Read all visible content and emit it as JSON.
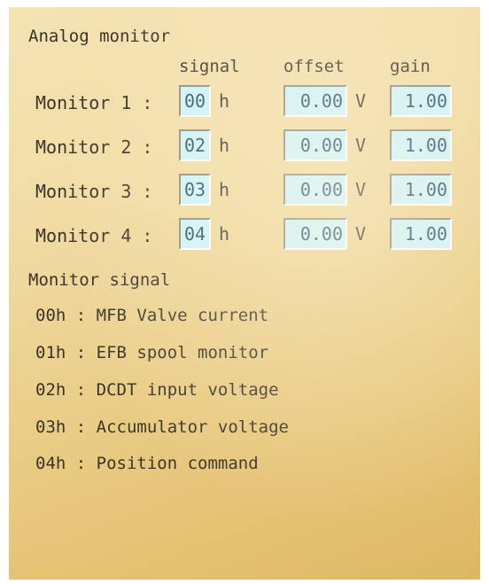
{
  "panel": {
    "title": "Analog monitor",
    "columns": {
      "signal": "signal",
      "offset": "offset",
      "gain": "gain"
    },
    "signal_unit": "h",
    "offset_unit": "V",
    "monitors": [
      {
        "label": "Monitor 1 :",
        "signal": "00",
        "offset": "0.00",
        "gain": "1.00"
      },
      {
        "label": "Monitor 2 :",
        "signal": "02",
        "offset": "0.00",
        "gain": "1.00"
      },
      {
        "label": "Monitor 3 :",
        "signal": "03",
        "offset": "0.00",
        "gain": "1.00"
      },
      {
        "label": "Monitor 4 :",
        "signal": "04",
        "offset": "0.00",
        "gain": "1.00"
      }
    ]
  },
  "signals": {
    "title": "Monitor signal",
    "items": [
      "00h : MFB Valve current",
      "01h : EFB spool monitor",
      "02h : DCDT input voltage",
      "03h : Accumulator voltage",
      "04h : Position command"
    ]
  },
  "colors": {
    "field_bg": "#cdf4fb",
    "screen_bg": "#f1dca5",
    "text": "#3a3328"
  }
}
